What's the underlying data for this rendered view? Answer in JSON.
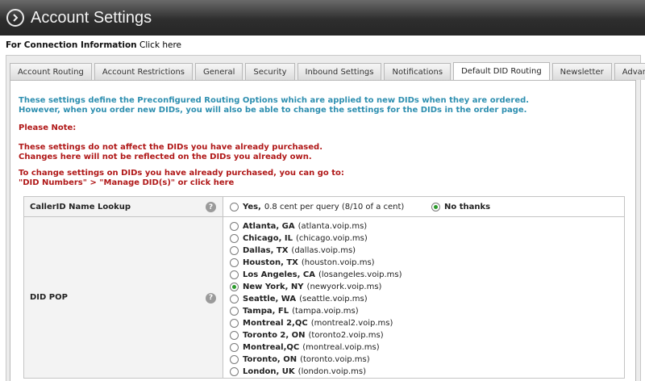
{
  "header": {
    "title": "Account Settings"
  },
  "connection": {
    "label": "For Connection Information",
    "link": "Click here"
  },
  "tabs": [
    {
      "label": "Account Routing"
    },
    {
      "label": "Account Restrictions"
    },
    {
      "label": "General"
    },
    {
      "label": "Security"
    },
    {
      "label": "Inbound Settings"
    },
    {
      "label": "Notifications"
    },
    {
      "label": "Default DID Routing",
      "active": true
    },
    {
      "label": "Newsletter"
    },
    {
      "label": "Advanced"
    }
  ],
  "info": {
    "line1": "These settings define the Preconfigured Routing Options which are applied to new DIDs when they are ordered.",
    "line2": "However, when you order new DIDs, you will also be able to change the settings for the DIDs in the order page."
  },
  "note": {
    "title": "Please Note:",
    "line1": "These settings do not affect the DIDs you have already purchased.",
    "line2": "Changes here will not be reflected on the DIDs you already own.",
    "line3": "To change settings on DIDs you have already purchased, you can go to:",
    "line4": "\"DID Numbers\" > \"Manage DID(s)\" or click here"
  },
  "callerid": {
    "label": "CallerID Name Lookup",
    "yes_bold": "Yes,",
    "yes_text": "0.8 cent per query (8/10 of a cent)",
    "no_label": "No thanks",
    "selected": "no"
  },
  "did_pop": {
    "label": "DID POP",
    "options": [
      {
        "name": "Atlanta, GA",
        "host": "(atlanta.voip.ms)",
        "selected": false
      },
      {
        "name": "Chicago, IL",
        "host": "(chicago.voip.ms)",
        "selected": false
      },
      {
        "name": "Dallas, TX",
        "host": "(dallas.voip.ms)",
        "selected": false
      },
      {
        "name": "Houston, TX",
        "host": "(houston.voip.ms)",
        "selected": false
      },
      {
        "name": "Los Angeles, CA",
        "host": "(losangeles.voip.ms)",
        "selected": false
      },
      {
        "name": "New York, NY",
        "host": "(newyork.voip.ms)",
        "selected": true
      },
      {
        "name": "Seattle, WA",
        "host": "(seattle.voip.ms)",
        "selected": false
      },
      {
        "name": "Tampa, FL",
        "host": "(tampa.voip.ms)",
        "selected": false
      },
      {
        "name": "Montreal 2,QC",
        "host": "(montreal2.voip.ms)",
        "selected": false
      },
      {
        "name": "Toronto 2, ON",
        "host": "(toronto2.voip.ms)",
        "selected": false
      },
      {
        "name": "Montreal,QC",
        "host": "(montreal.voip.ms)",
        "selected": false
      },
      {
        "name": "Toronto, ON",
        "host": "(toronto.voip.ms)",
        "selected": false
      },
      {
        "name": "London, UK",
        "host": "(london.voip.ms)",
        "selected": false
      }
    ]
  },
  "help_symbol": "?",
  "colors": {
    "info": "#2e8fb0",
    "note": "#b01818",
    "radio_selected": "#2b9a2b"
  }
}
